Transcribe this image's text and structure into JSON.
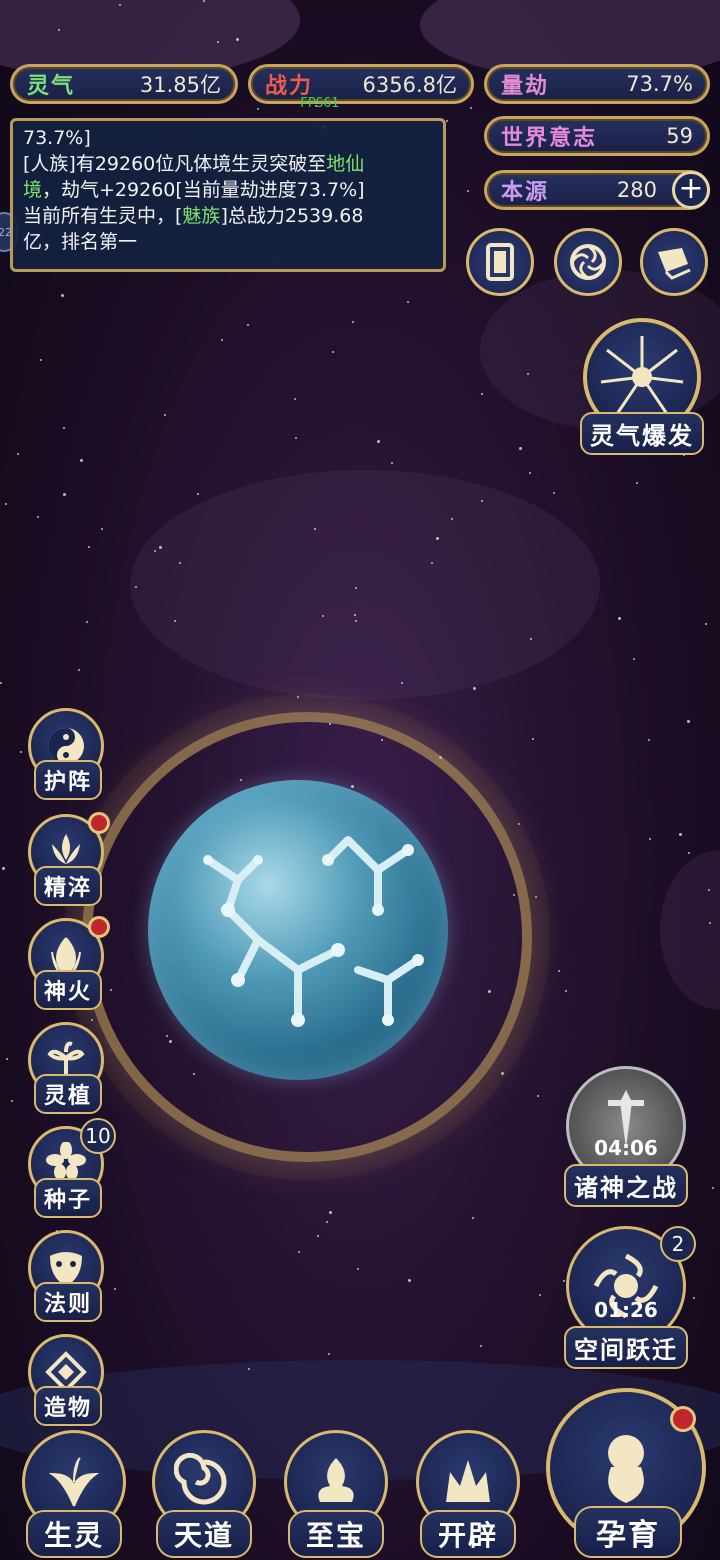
{
  "hud": {
    "fps": "FPS61",
    "lingqi": {
      "label": "灵气",
      "value": "31.85亿"
    },
    "zhanli": {
      "label": "战力",
      "value": "6356.8亿"
    },
    "liangjie": {
      "label": "量劫",
      "value": "73.7%"
    },
    "shijie": {
      "label": "世界意志",
      "value": "59"
    },
    "benyuan": {
      "label": "本源",
      "value": "280",
      "add": "+"
    }
  },
  "log": {
    "line1": "73.7%]",
    "line2a": "[人族]有29260位凡体境生灵突破至",
    "line2b": "地仙",
    "line3a": "境",
    "line3b": "，劫气+29260[当前量劫进度73.7%]",
    "line4a": "当前所有生灵中，[",
    "line4b": "魅族",
    "line4c": "]总战力2539.68",
    "line5": "亿，排名第一",
    "side_tab": "22"
  },
  "right_features": {
    "burst": {
      "label": "灵气爆发"
    },
    "gods_war": {
      "label": "诸神之战",
      "timer": "04:06"
    },
    "space_jump": {
      "label": "空间跃迁",
      "timer": "01:26",
      "badge": "2"
    }
  },
  "left_menu": [
    {
      "label": "护阵",
      "icon": "yin-yang-icon"
    },
    {
      "label": "精淬",
      "icon": "lotus-flame-icon"
    },
    {
      "label": "神火",
      "icon": "flame-icon"
    },
    {
      "label": "灵植",
      "icon": "plant-icon"
    },
    {
      "label": "种子",
      "icon": "flower-icon",
      "badge": "10"
    },
    {
      "label": "法则",
      "icon": "mask-icon"
    },
    {
      "label": "造物",
      "icon": "diamond-icon"
    }
  ],
  "bottom_nav": [
    {
      "label": "生灵",
      "icon": "phoenix-icon"
    },
    {
      "label": "天道",
      "icon": "swirl-icon"
    },
    {
      "label": "至宝",
      "icon": "treasure-icon"
    },
    {
      "label": "开辟",
      "icon": "fire-crown-icon"
    }
  ],
  "incubate": {
    "label": "孕育"
  },
  "colors": {
    "gold": "#d9b96c",
    "navy": "#1b2650",
    "green": "#7be07a",
    "red": "#f05a4e"
  }
}
